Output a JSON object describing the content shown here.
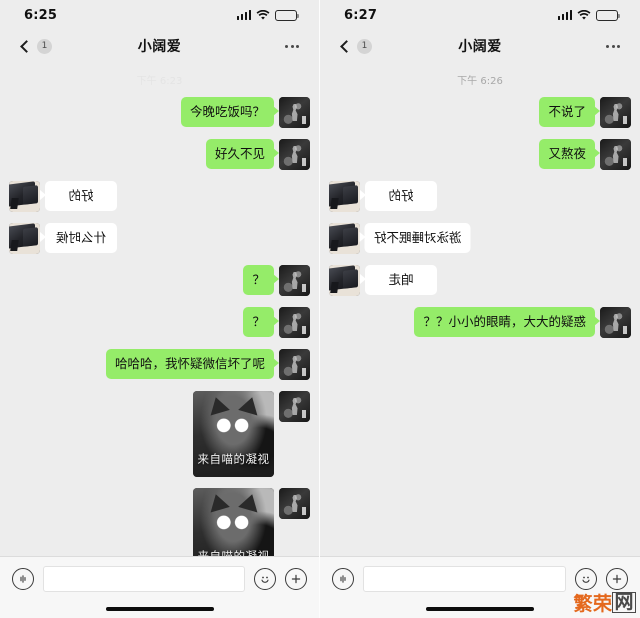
{
  "app": {
    "name": "WeChat Chat Screenshot",
    "accent_green": "#95ec69",
    "background": "#ededed",
    "bubble_white": "#ffffff"
  },
  "watermark": {
    "text_primary": "繁荣",
    "text_boxed": "网"
  },
  "panels": [
    {
      "id": "left",
      "statusbar": {
        "time": "6:25",
        "signal_icon": "signal-bars-icon",
        "wifi_icon": "wifi-icon",
        "battery_icon": "battery-icon"
      },
      "navbar": {
        "back_icon": "chevron-left-icon",
        "unread_badge": "1",
        "title": "小阔爱",
        "more_icon": "more-dots-icon"
      },
      "daystamp": "下午 6:23",
      "daystamp_faded": true,
      "messages": [
        {
          "side": "out",
          "type": "text",
          "text": "今晚吃饭吗？",
          "mirrored": false
        },
        {
          "side": "out",
          "type": "text",
          "text": "好久不见",
          "mirrored": false
        },
        {
          "side": "in",
          "type": "text",
          "text": "好的",
          "mirrored": true
        },
        {
          "side": "in",
          "type": "text",
          "text": "什么时候",
          "mirrored": true
        },
        {
          "side": "out",
          "type": "text",
          "text": "？",
          "mirrored": false
        },
        {
          "side": "out",
          "type": "text",
          "text": "？",
          "mirrored": false
        },
        {
          "side": "out",
          "type": "text",
          "text": "哈哈哈，我怀疑微信坏了呢",
          "mirrored": false
        },
        {
          "side": "out",
          "type": "sticker",
          "caption": "来自喵的凝视"
        },
        {
          "side": "out",
          "type": "sticker",
          "caption": "来自喵的凝视"
        }
      ],
      "inputbar": {
        "voice_icon": "voice-wave-icon",
        "input_value": "",
        "input_placeholder": "",
        "emoji_icon": "smiley-icon",
        "plus_icon": "plus-icon"
      }
    },
    {
      "id": "right",
      "statusbar": {
        "time": "6:27",
        "signal_icon": "signal-bars-icon",
        "wifi_icon": "wifi-icon",
        "battery_icon": "battery-icon"
      },
      "navbar": {
        "back_icon": "chevron-left-icon",
        "unread_badge": "1",
        "title": "小阔爱",
        "more_icon": "more-dots-icon"
      },
      "daystamp": "下午 6:26",
      "daystamp_faded": false,
      "messages": [
        {
          "side": "out",
          "type": "text",
          "text": "不说了",
          "mirrored": false
        },
        {
          "side": "out",
          "type": "text",
          "text": "又熬夜",
          "mirrored": false
        },
        {
          "side": "in",
          "type": "text",
          "text": "好的",
          "mirrored": true
        },
        {
          "side": "in",
          "type": "text",
          "text": "游泳对睡眠不好",
          "mirrored": true
        },
        {
          "side": "in",
          "type": "text",
          "text": "咱走",
          "mirrored": true
        },
        {
          "side": "out",
          "type": "text",
          "text": "？？小小的眼睛，大大的疑惑",
          "mirrored": false
        }
      ],
      "inputbar": {
        "voice_icon": "voice-wave-icon",
        "input_value": "",
        "input_placeholder": "",
        "emoji_icon": "smiley-icon",
        "plus_icon": "plus-icon"
      }
    }
  ]
}
